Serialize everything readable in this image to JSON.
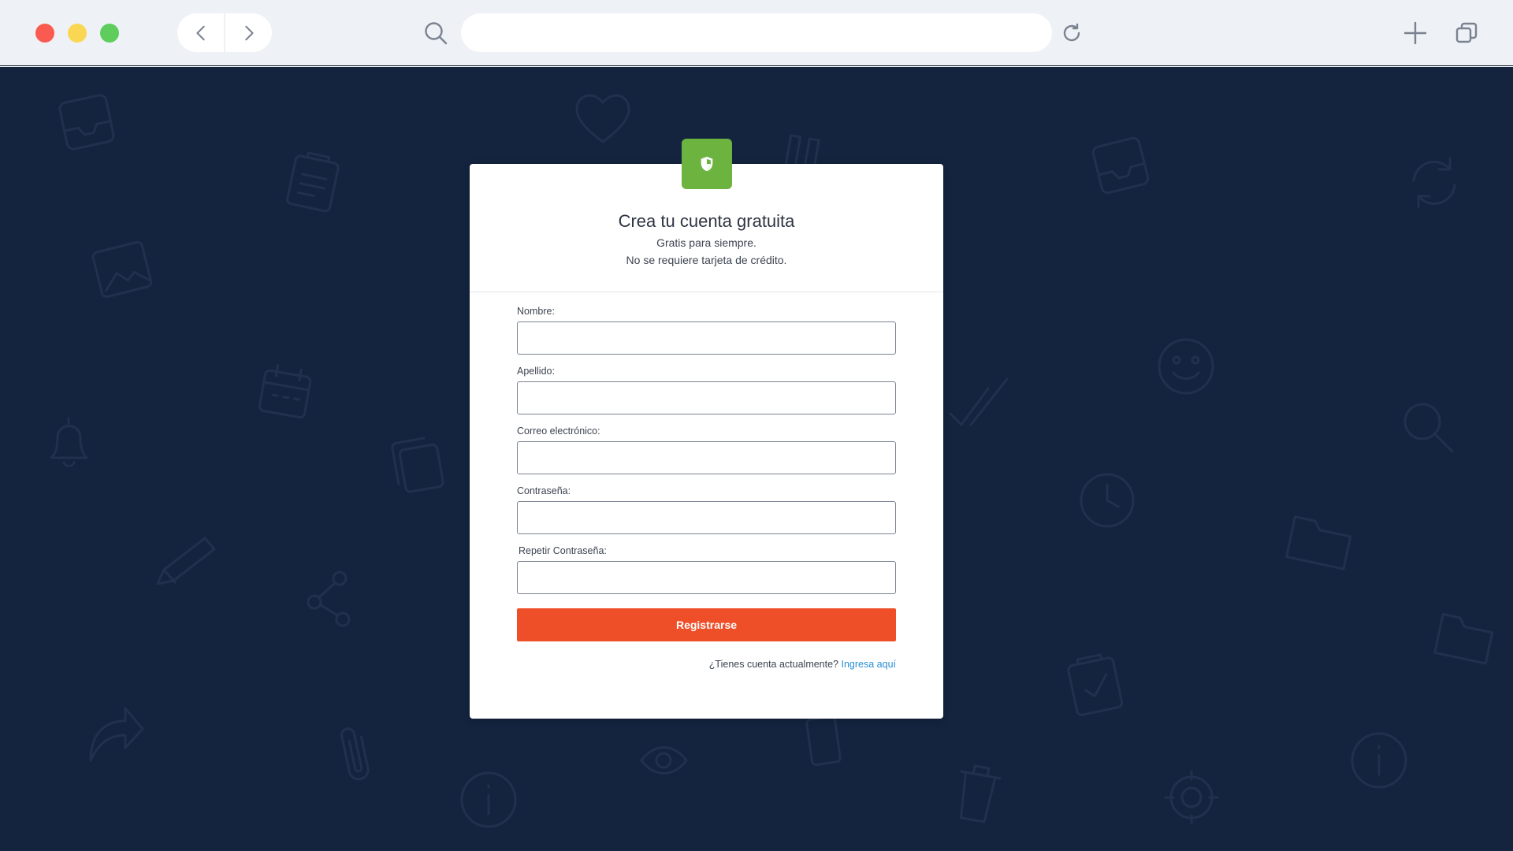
{
  "browser": {
    "address_placeholder": "",
    "address_value": ""
  },
  "icons": {
    "back": "chevron-left-icon",
    "forward": "chevron-right-icon",
    "search": "search-icon",
    "reload": "reload-icon",
    "new_tab": "plus-icon",
    "tabs": "tabs-icon",
    "badge": "shield-icon"
  },
  "colors": {
    "page_background": "#14243f",
    "badge": "#6cb33f",
    "submit": "#ee4f28",
    "link": "#2a8fd3"
  },
  "form": {
    "title": "Crea tu cuenta gratuita",
    "subtitle_1": "Gratis para siempre.",
    "subtitle_2": "No se requiere tarjeta de crédito.",
    "fields": [
      {
        "label": "Nombre:",
        "value": ""
      },
      {
        "label": "Apellido:",
        "value": ""
      },
      {
        "label": "Correo electrónico:",
        "value": ""
      },
      {
        "label": "Contraseña:",
        "value": ""
      },
      {
        "label": "Repetir Contraseña:",
        "value": ""
      }
    ],
    "submit_label": "Registrarse",
    "login_prompt": "¿Tienes cuenta actualmente?",
    "login_link": "Ingresa aquí"
  }
}
